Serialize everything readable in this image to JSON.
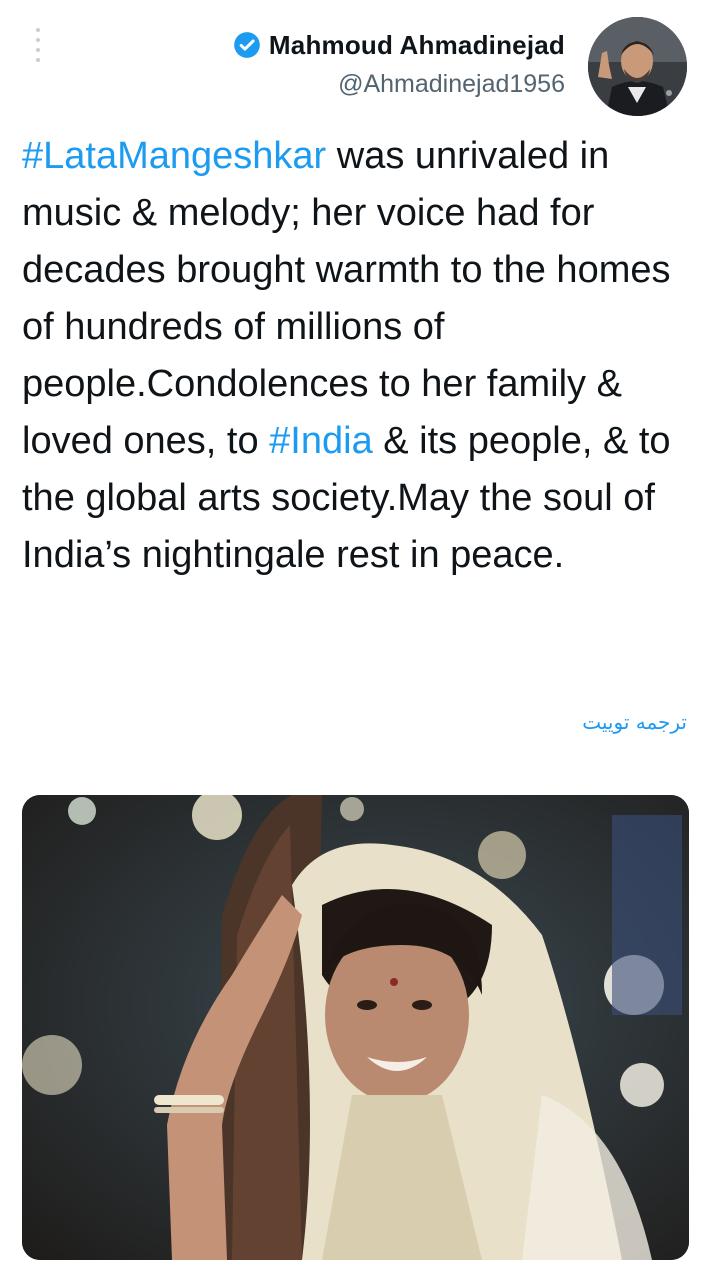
{
  "author": {
    "display_name": "Mahmoud Ahmadinejad",
    "handle": "@Ahmadinejad1956",
    "verified": true
  },
  "tweet": {
    "segments": [
      {
        "text": "#LataMangeshkar",
        "type": "hashtag"
      },
      {
        "text": " was unrivaled in music & melody; her voice had for decades brought warmth to the homes of hundreds of millions of people.Condolences to her family & loved ones, to ",
        "type": "text"
      },
      {
        "text": "#India",
        "type": "hashtag"
      },
      {
        "text": " & its people, & to the global arts society.May the soul of India’s nightingale rest in peace.",
        "type": "text"
      }
    ],
    "translate_label": "ترجمه توییت"
  },
  "icons": {
    "more": "more-vertical-icon",
    "verified": "verified-badge-icon"
  },
  "colors": {
    "accent": "#1d9bf0",
    "text": "#0f1419",
    "secondary": "#536471"
  }
}
